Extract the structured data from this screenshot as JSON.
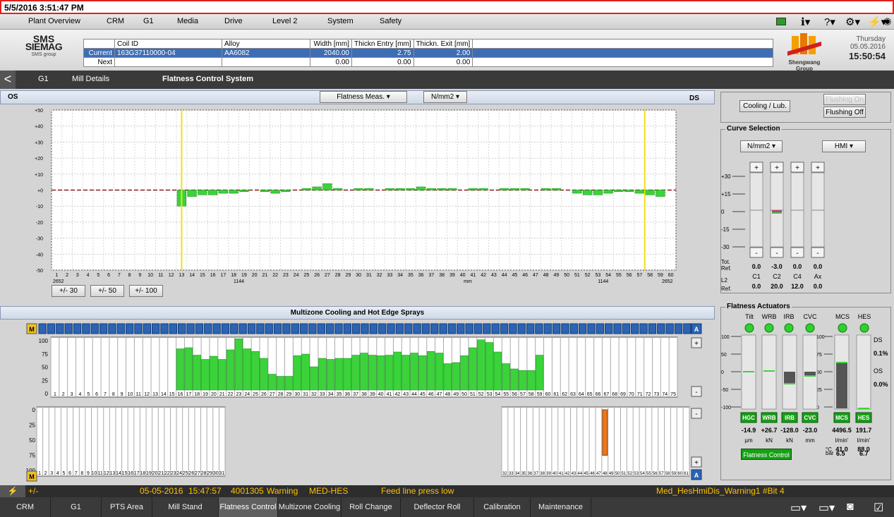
{
  "window": {
    "timestamp": "5/5/2016 3:51:47 PM"
  },
  "menu": [
    "Plant Overview",
    "CRM",
    "G1",
    "Media",
    "Drive",
    "Level 2",
    "System",
    "Safety"
  ],
  "logo": {
    "line1": "SMS",
    "line2": "SIEMAG",
    "line3": "SMS group",
    "company": "Shengwang Group"
  },
  "datetime": {
    "weekday": "Thursday",
    "date": "05.05.2016",
    "time": "15:50:54"
  },
  "coil": {
    "headers": [
      "Coil ID",
      "Alloy",
      "Width [mm]",
      "Thickn Entry [mm]",
      "Thickn. Exit [mm]"
    ],
    "current": {
      "label": "Current",
      "coil_id": "163G37110000-04",
      "alloy": "AA6082",
      "width": "2040.00",
      "entry": "2.75",
      "exit": "2.00"
    },
    "next": {
      "label": "Next",
      "coil_id": "",
      "alloy": "",
      "width": "0.00",
      "entry": "0.00",
      "exit": "0.00"
    }
  },
  "breadcrumb": {
    "back": "<",
    "items": [
      "G1",
      "Mill Details",
      "Flatness Control System"
    ]
  },
  "flatness": {
    "os_label": "OS",
    "ds_label": "DS",
    "meas_select": "Flatness Meas.",
    "unit_select": "N/mm2",
    "y_ticks": [
      "+50",
      "+40",
      "+30",
      "+20",
      "+10",
      "+0",
      "-10",
      "-20",
      "-30",
      "-40",
      "-50"
    ],
    "x_left": "2652",
    "x_right": "2652",
    "x_mid_left": "1144",
    "x_mid_right": "1144",
    "x_unit": "mm",
    "scale_buttons": [
      "+/- 30",
      "+/- 50",
      "+/- 100"
    ]
  },
  "chart_data": {
    "type": "bar",
    "title": "",
    "ylim": [
      -50,
      50
    ],
    "categories_count": 60,
    "series": [
      {
        "values": [
          0,
          0,
          0,
          0,
          0,
          0,
          0,
          0,
          0,
          0,
          0,
          0,
          -10,
          -4,
          -3,
          -3,
          -2,
          -2,
          -1,
          0,
          -1,
          -2,
          -1,
          0,
          1,
          2,
          4,
          1,
          0,
          1,
          1,
          0,
          1,
          1,
          1,
          2,
          1,
          1,
          1,
          0,
          1,
          1,
          0,
          1,
          1,
          1,
          0,
          1,
          1,
          0,
          -2,
          -3,
          -3,
          -2,
          -1,
          -1,
          -2,
          -3,
          -4,
          0
        ]
      }
    ]
  },
  "sprays": {
    "title": "Multizone Cooling and Hot Edge Sprays",
    "m_label": "M",
    "a_label": "A",
    "plus": "+",
    "minus": "-",
    "top_y_ticks": [
      "100",
      "75",
      "50",
      "25",
      "0"
    ],
    "bot_y_ticks": [
      "0",
      "25",
      "50",
      "75",
      "100"
    ],
    "top_values": [
      0,
      0,
      0,
      0,
      0,
      0,
      0,
      0,
      0,
      0,
      0,
      0,
      0,
      0,
      0,
      78,
      80,
      66,
      58,
      64,
      58,
      76,
      97,
      78,
      73,
      60,
      30,
      26,
      26,
      65,
      68,
      44,
      60,
      58,
      60,
      60,
      66,
      70,
      66,
      65,
      66,
      72,
      66,
      70,
      65,
      73,
      70,
      50,
      52,
      65,
      80,
      95,
      90,
      72,
      50,
      40,
      37,
      37,
      66,
      0,
      0,
      0,
      0,
      0,
      0,
      0,
      0,
      0,
      0,
      0,
      0,
      0,
      0,
      0,
      0
    ],
    "bot_orange_index": 47,
    "bot_orange_value": 75
  },
  "right": {
    "cooling_btn": "Cooling / Lub.",
    "flushing_on": "Flushing On",
    "flushing_off": "Flushing Off",
    "curve_title": "Curve Selection",
    "curve_unit": "N/mm2",
    "curve_hmi": "HMI",
    "curve_ticks": [
      "+30",
      "+15",
      "0",
      "-15",
      "-30"
    ],
    "curve_cols": [
      "C1",
      "C2",
      "C4",
      "Ax"
    ],
    "tot_ref": "Tot. Ref.",
    "tot_vals": [
      "0.0",
      "-3.0",
      "0.0",
      "0.0"
    ],
    "l2_ref": "L2 Ref.",
    "l2_vals": [
      "0.0",
      "20.0",
      "12.0",
      "0.0"
    ],
    "act_title": "Flatness Actuators",
    "act_cols": [
      "Tilt",
      "WRB",
      "IRB",
      "CVC",
      "MCS",
      "HES"
    ],
    "act_tags": [
      "HGC",
      "WRB",
      "IRB",
      "CVC",
      "MCS",
      "HES"
    ],
    "act_vals": [
      "-14.9",
      "+26.7",
      "-128.0",
      "-23.0",
      "4496.5",
      "191.7"
    ],
    "act_units": [
      "µm",
      "kN",
      "kN",
      "mm",
      "l/min'",
      "l/min'"
    ],
    "left_ticks": [
      "100",
      "50",
      "0",
      "-50",
      "-100"
    ],
    "mcs_ticks": [
      "100",
      "75",
      "50",
      "25",
      "0"
    ],
    "ds": "DS",
    "ds_val": "0.1%",
    "os": "OS",
    "os_val": "0.0%",
    "temp_label": "°C",
    "temp_vals": [
      "41.0",
      "88.0"
    ],
    "bar_label": "bar",
    "bar_vals": [
      "6.5",
      "6.7"
    ],
    "fc_btn": "Flatness Control"
  },
  "status": {
    "icon": "⚡",
    "text": "+/-",
    "date": "05-05-2016",
    "time": "15:47:57",
    "code": "4001305",
    "level": "Warning",
    "src": "MED-HES",
    "msg": "Feed line press low",
    "tag": "Med_HesHmiDis_Warning1 #Bit 4"
  },
  "bottom_nav": [
    "CRM",
    "G1",
    "PTS Area",
    "Mill Stand",
    "Flatness Control",
    "Multizone Cooling",
    "Roll Change",
    "Deflector Roll",
    "Calibration",
    "Maintenance"
  ]
}
